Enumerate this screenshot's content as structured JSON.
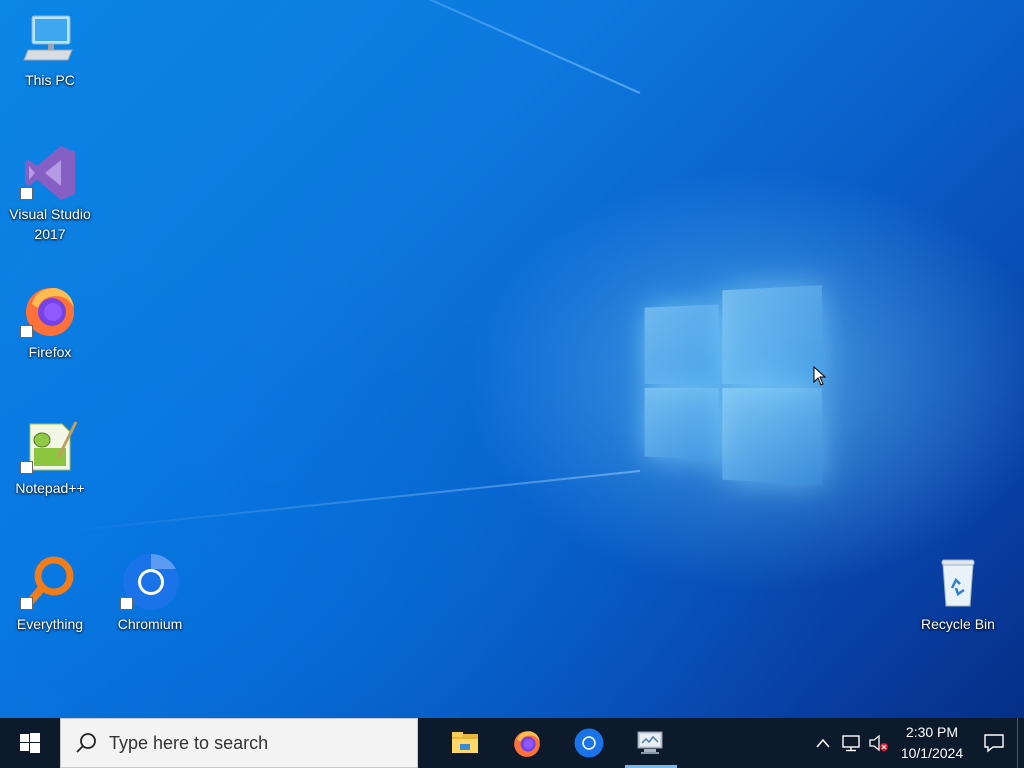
{
  "desktop": {
    "icons": [
      {
        "label": "This PC",
        "icon": "this-pc-icon"
      },
      {
        "label": "Visual Studio 2017",
        "icon": "visual-studio-icon"
      },
      {
        "label": "Firefox",
        "icon": "firefox-icon"
      },
      {
        "label": "Notepad++",
        "icon": "notepad-plus-plus-icon"
      },
      {
        "label": "Everything",
        "icon": "everything-search-icon"
      },
      {
        "label": "Chromium",
        "icon": "chromium-icon"
      },
      {
        "label": "Recycle Bin",
        "icon": "recycle-bin-icon"
      }
    ]
  },
  "taskbar": {
    "search_placeholder": "Type here to search",
    "pinned_apps": [
      {
        "name": "File Explorer",
        "icon": "file-explorer-icon"
      },
      {
        "name": "Firefox",
        "icon": "firefox-icon"
      },
      {
        "name": "Chromium",
        "icon": "chromium-icon"
      },
      {
        "name": "Remote Desktop",
        "icon": "remote-desktop-icon"
      }
    ],
    "clock": {
      "time": "2:30 PM",
      "date": "10/1/2024"
    }
  },
  "colors": {
    "taskbar_bg": "#0d1a2b",
    "desktop_blue": "#0a78e0",
    "active_indicator": "#76b9ed"
  }
}
